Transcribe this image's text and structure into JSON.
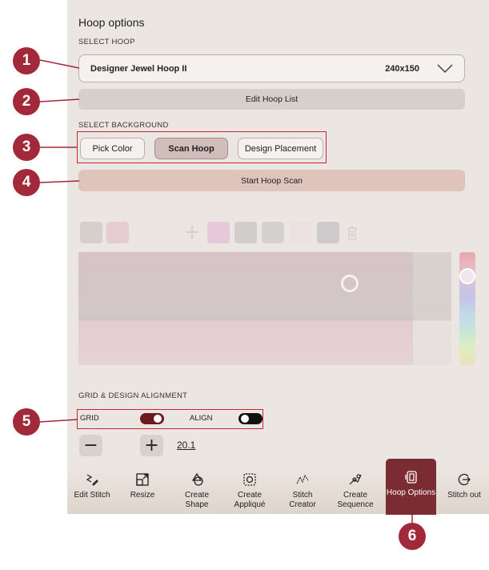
{
  "panel": {
    "title": "Hoop options"
  },
  "select_hoop": {
    "label": "SELECT HOOP",
    "hoop_name": "Designer Jewel Hoop II",
    "hoop_size": "240x150",
    "edit_list_label": "Edit Hoop List"
  },
  "background": {
    "label": "SELECT BACKGROUND",
    "options": [
      "Pick Color",
      "Scan Hoop",
      "Design Placement"
    ],
    "selected": "Scan Hoop",
    "start_scan_label": "Start Hoop Scan"
  },
  "swatches": {
    "colors": [
      "#d5d0cc",
      "#e6ccd2",
      "#e6c9d8",
      "#d1cdca",
      "#d5d1ce",
      "#ece1e1",
      "#cfcacb"
    ],
    "icons": [
      "plus-icon",
      "trash-icon"
    ]
  },
  "grid": {
    "label": "GRID & DESIGN ALIGNMENT",
    "grid_label": "GRID",
    "align_label": "ALIGN",
    "grid_on": true,
    "align_on": false,
    "grid_size": "20.1"
  },
  "toolbar": {
    "items": [
      {
        "label": "Edit Stitch",
        "icon": "edit-stitch-icon"
      },
      {
        "label": "Resize",
        "icon": "resize-icon"
      },
      {
        "label": "Create Shape",
        "icon": "shape-icon"
      },
      {
        "label": "Create Appliqué",
        "icon": "applique-icon"
      },
      {
        "label": "Stitch Creator",
        "icon": "stitch-creator-icon"
      },
      {
        "label": "Create Sequence",
        "icon": "sequence-icon"
      },
      {
        "label": "Hoop Options",
        "icon": "hoop-options-icon"
      },
      {
        "label": "Stitch out",
        "icon": "stitch-out-icon"
      }
    ],
    "active": "Hoop Options"
  },
  "callouts": [
    "1",
    "2",
    "3",
    "4",
    "5",
    "6"
  ],
  "colors": {
    "accent": "#7b2c32",
    "callout": "#a2293a",
    "highlight_box": "#c8253a",
    "toggle_on": "#6b1b1f",
    "toggle_off": "#111111"
  }
}
